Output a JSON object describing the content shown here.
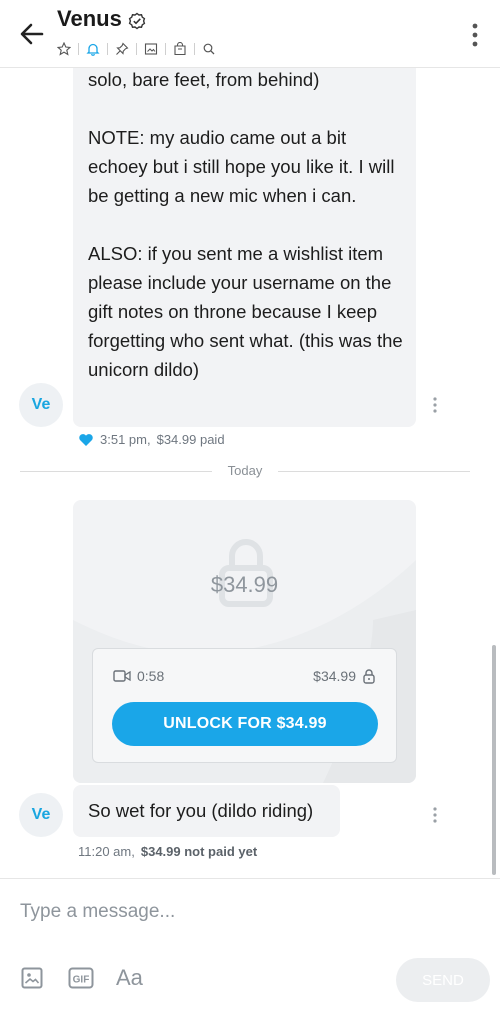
{
  "header": {
    "title": "Venus",
    "icons": [
      "star-icon",
      "bell-icon",
      "pin-icon",
      "image-icon",
      "tag-icon",
      "search-icon"
    ]
  },
  "messages": [
    {
      "avatar": "Ve",
      "text": "solo, bare feet, from behind)\n\nNOTE: my audio came out a bit echoey but i still hope you like it. I will be getting a new mic when i can.\n\nALSO: if you sent me a wishlist item please include your username on the gift notes on throne because I keep forgetting who sent what. (this was the unicorn dildo)",
      "time": "3:51 pm,",
      "price_status": "$34.99 paid"
    }
  ],
  "divider": {
    "label": "Today"
  },
  "locked_post": {
    "price": "$34.99",
    "duration": "0:58",
    "panel_price": "$34.99",
    "unlock_label": "UNLOCK FOR $34.99",
    "caption": "So wet for you (dildo riding)",
    "avatar": "Ve",
    "time": "11:20 am,",
    "price_status": "$34.99 not paid yet"
  },
  "composer": {
    "placeholder": "Type a message...",
    "aa_label": "Aa",
    "gif_label": "GIF",
    "send_label": "SEND"
  },
  "colors": {
    "accent": "#1aa6e8",
    "bubble": "#f2f3f5"
  }
}
